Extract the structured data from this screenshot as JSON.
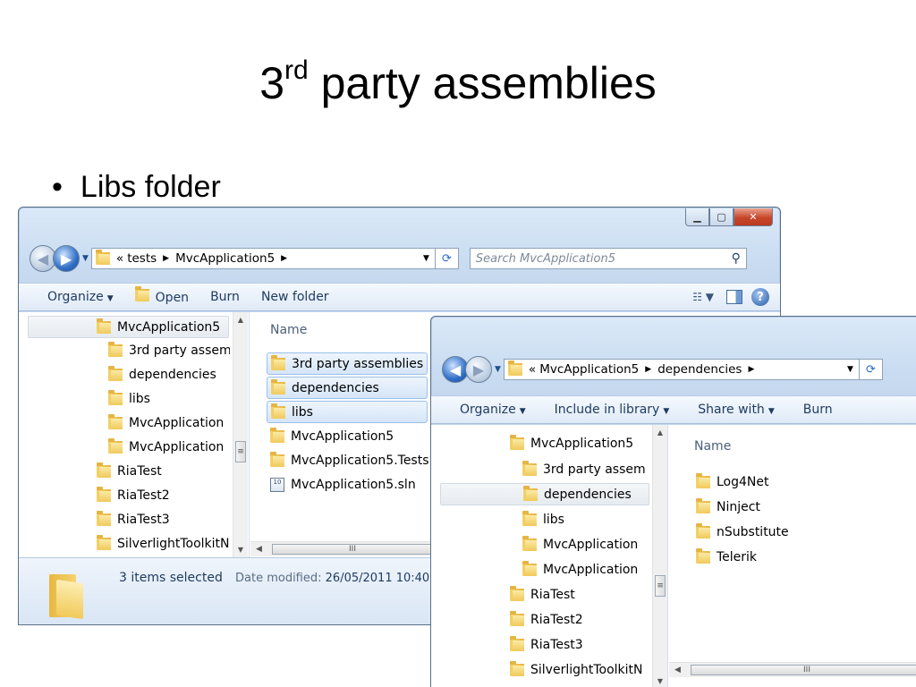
{
  "slide": {
    "title_main": "3",
    "title_sup": "rd",
    "title_rest": " party assemblies",
    "bullet": "Libs folder"
  },
  "window1": {
    "caption": {
      "minimize": "▁",
      "maximize": "▢",
      "close": "✕"
    },
    "address": {
      "overflow": "«",
      "path": [
        "tests",
        "MvcApplication5"
      ]
    },
    "search_placeholder": "Search MvcApplication5",
    "toolbar": {
      "organize": "Organize",
      "open": "Open",
      "burn": "Burn",
      "new_folder": "New folder"
    },
    "nav_tree": [
      "MvcApplication5",
      "3rd party assem",
      "dependencies",
      "libs",
      "MvcApplication",
      "MvcApplication",
      "RiaTest",
      "RiaTest2",
      "RiaTest3",
      "SilverlightToolkitN"
    ],
    "column_name": "Name",
    "files": [
      {
        "name": "3rd party assemblies",
        "type": "folder",
        "selected": true
      },
      {
        "name": "dependencies",
        "type": "folder",
        "selected": true
      },
      {
        "name": "libs",
        "type": "folder",
        "selected": true
      },
      {
        "name": "MvcApplication5",
        "type": "folder",
        "selected": false
      },
      {
        "name": "MvcApplication5.Tests",
        "type": "folder",
        "selected": false
      },
      {
        "name": "MvcApplication5.sln",
        "type": "solution",
        "selected": false
      }
    ],
    "details": {
      "count": "3 items selected",
      "date_label": "Date modified:",
      "date_value": "26/05/2011 10:40"
    }
  },
  "window2": {
    "address": {
      "overflow": "«",
      "path": [
        "MvcApplication5",
        "dependencies"
      ]
    },
    "toolbar": {
      "organize": "Organize",
      "include": "Include in library",
      "share": "Share with",
      "burn": "Burn"
    },
    "nav_tree": [
      "MvcApplication5",
      "3rd party assem",
      "dependencies",
      "libs",
      "MvcApplication",
      "MvcApplication",
      "RiaTest",
      "RiaTest2",
      "RiaTest3",
      "SilverlightToolkitN"
    ],
    "column_name": "Name",
    "files": [
      "Log4Net",
      "Ninject",
      "nSubstitute",
      "Telerik"
    ]
  },
  "glyphs": {
    "scroll_up": "▲",
    "scroll_down": "▼",
    "scroll_left": "◀",
    "grip": "III",
    "vgrip": "≡"
  },
  "colors": {
    "close_button": "#c7462a",
    "selection": "#d5e5f8",
    "toolbar_text": "#1e3a5f"
  }
}
